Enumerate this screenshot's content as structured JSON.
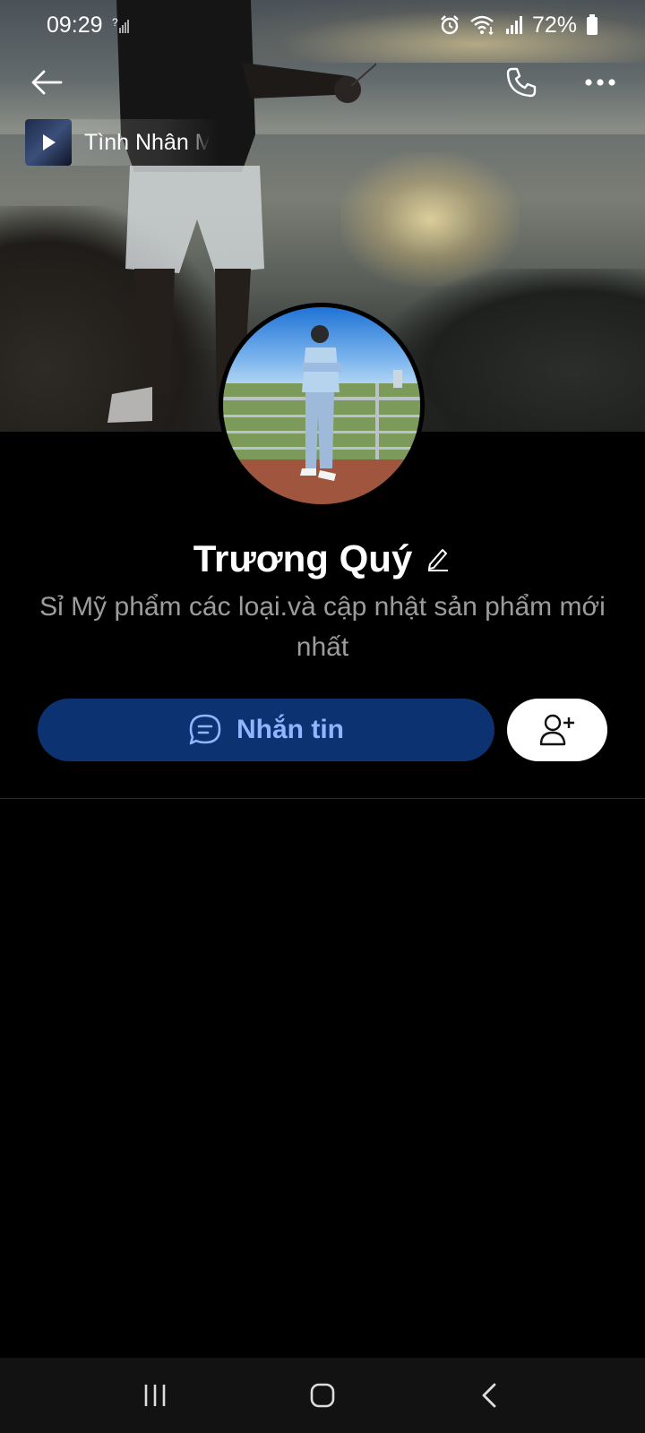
{
  "status_bar": {
    "time": "09:29",
    "battery": "72%"
  },
  "top_bar": {
    "back_icon": "arrow-left-icon",
    "call_icon": "phone-icon",
    "more_icon": "more-horizontal-icon"
  },
  "music": {
    "title": "Tình Nhân M"
  },
  "profile": {
    "name": "Trương Quý",
    "bio": "Sỉ Mỹ phẩm các loại.và cập nhật sản phẩm mới nhất"
  },
  "actions": {
    "message_label": "Nhắn tin"
  },
  "colors": {
    "message_button_bg": "#0c3271",
    "message_button_text": "#8fb6ff",
    "bio_text": "#9c9c9c",
    "background": "#000000"
  }
}
